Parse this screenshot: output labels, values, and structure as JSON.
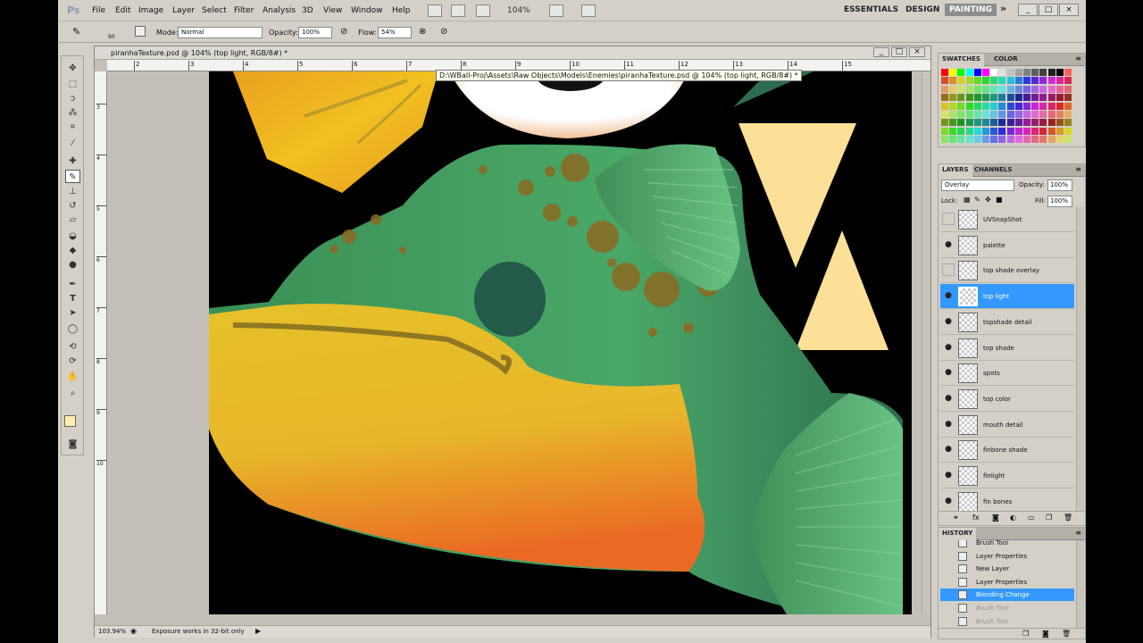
{
  "app": {
    "logo": "Ps"
  },
  "menu": [
    "File",
    "Edit",
    "Image",
    "Layer",
    "Select",
    "Filter",
    "Analysis",
    "3D",
    "View",
    "Window",
    "Help"
  ],
  "zoom": "104%",
  "workspaces": {
    "essentials": "ESSENTIALS",
    "design": "DESIGN",
    "painting": "PAINTING",
    "more": "»"
  },
  "options": {
    "brush_size": "90",
    "mode_label": "Mode:",
    "mode_value": "Normal",
    "opacity_label": "Opacity:",
    "opacity_value": "100%",
    "flow_label": "Flow:",
    "flow_value": "54%"
  },
  "document": {
    "title": "piranhaTexture.psd @ 104% (top light, RGB/8#) *",
    "tooltip": "D:\\WBall-Proj\\Assets\\Raw Objects\\Models\\Enemies\\piranhaTexture.psd @ 104% (top light, RGB/8#) *",
    "zoom_status": "103.94%",
    "status_text": "Exposure works in 32-bit only",
    "ruler_h": [
      "2",
      "3",
      "4",
      "5",
      "6",
      "7",
      "8",
      "9",
      "10",
      "11",
      "12",
      "13",
      "14",
      "15"
    ],
    "ruler_v": [
      "3",
      "4",
      "5",
      "6",
      "7",
      "8",
      "9",
      "10"
    ]
  },
  "swatches_panel": {
    "tabs": [
      "SWATCHES",
      "COLOR"
    ]
  },
  "layers_panel": {
    "tabs": [
      "LAYERS",
      "CHANNELS"
    ],
    "blend_mode": "Overlay",
    "opacity_label": "Opacity:",
    "opacity_value": "100%",
    "lock_label": "Lock:",
    "fill_label": "Fill:",
    "fill_value": "100%",
    "layers": [
      {
        "name": "UVSnapShot",
        "visible": false
      },
      {
        "name": "palette",
        "visible": true
      },
      {
        "name": "top shade overlay",
        "visible": false
      },
      {
        "name": "top light",
        "visible": true,
        "selected": true
      },
      {
        "name": "topshade detail",
        "visible": true
      },
      {
        "name": "top shade",
        "visible": true
      },
      {
        "name": "spots",
        "visible": true
      },
      {
        "name": "top color",
        "visible": true
      },
      {
        "name": "mouth detail",
        "visible": true
      },
      {
        "name": "finbone shade",
        "visible": true
      },
      {
        "name": "finlight",
        "visible": true
      },
      {
        "name": "fin bones",
        "visible": true
      }
    ]
  },
  "history_panel": {
    "tab": "HISTORY",
    "items": [
      {
        "name": "Brush Tool",
        "state": "normal"
      },
      {
        "name": "Layer Properties",
        "state": "normal"
      },
      {
        "name": "New Layer",
        "state": "normal"
      },
      {
        "name": "Layer Properties",
        "state": "normal"
      },
      {
        "name": "Blending Change",
        "state": "selected"
      },
      {
        "name": "Brush Tool",
        "state": "dim"
      },
      {
        "name": "Brush Tool",
        "state": "dim"
      }
    ]
  },
  "colors": {
    "selection": "#3399ff",
    "foreground_swatch": "#fff0b0",
    "background_swatch": "#ffffff"
  }
}
